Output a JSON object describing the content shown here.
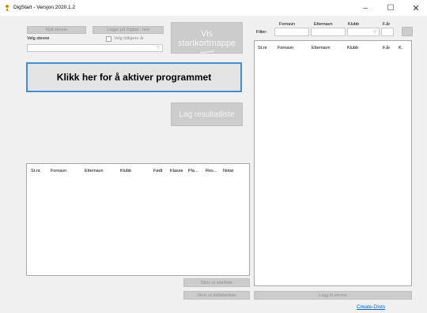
{
  "window": {
    "title": "DigStart - Versjon 2020.1.2",
    "min_glyph": "–",
    "max_glyph": "☐",
    "close_glyph": "✕"
  },
  "left": {
    "new_event_label": "Nytt stevne",
    "login_label": "Logge på Digital - nett",
    "select_event_label": "Velg stevne",
    "select_earlier_year_label": "Velg tidligere år",
    "show_start_folder_label": "Vis startkortmappe",
    "activate_label": "Klikk her for å aktiver programmet",
    "create_result_list_label": "Lag resultatliste",
    "table_headers": [
      "St.nr.",
      "Fornavn",
      "Etternavn",
      "Klubb",
      "Født",
      "Klasse",
      "Pla...",
      "Res...",
      "Notat"
    ],
    "print_start_list_label": "Skriv ut startliste",
    "print_participant_list_label": "Skriv ut deltakerliste"
  },
  "right": {
    "filter_label": "Filter:",
    "filter_headers": [
      "Fornavn",
      "Etternavn",
      "Klubb",
      "F.år"
    ],
    "table_headers": [
      "St.nr",
      "Fornavn",
      "Etternavn",
      "Klubb",
      "F.år",
      "K."
    ],
    "add_to_event_label": "Legg til stevne",
    "create_dists_link": "Create-Dists"
  },
  "colors": {
    "accent": "#3c8fd8",
    "disabled_button": "#cccccc",
    "disabled_text": "#8f8f8f",
    "link": "#0066cc",
    "window_bg": "#f0f0f0"
  }
}
